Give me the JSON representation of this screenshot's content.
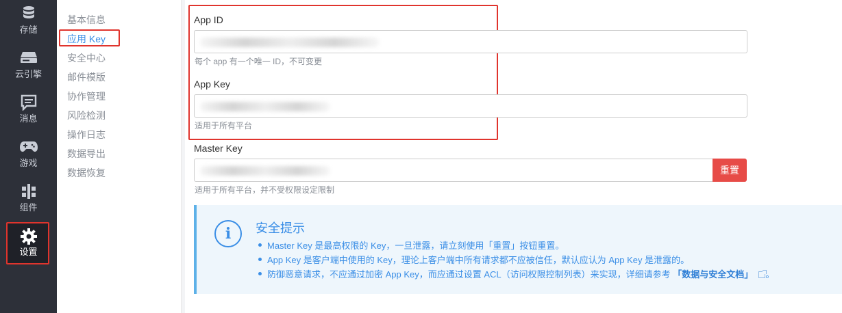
{
  "left_nav": {
    "items": [
      {
        "label": "存储",
        "icon": "database-icon"
      },
      {
        "label": "云引擎",
        "icon": "server-icon"
      },
      {
        "label": "消息",
        "icon": "message-icon"
      },
      {
        "label": "游戏",
        "icon": "gamepad-icon"
      },
      {
        "label": "组件",
        "icon": "component-icon"
      },
      {
        "label": "设置",
        "icon": "gear-icon",
        "active": true
      }
    ]
  },
  "sub_nav": {
    "items": [
      {
        "label": "基本信息"
      },
      {
        "label": "应用 Key",
        "active": true
      },
      {
        "label": "安全中心"
      },
      {
        "label": "邮件模版"
      },
      {
        "label": "协作管理"
      },
      {
        "label": "风险检测"
      },
      {
        "label": "操作日志"
      },
      {
        "label": "数据导出"
      },
      {
        "label": "数据恢复"
      }
    ]
  },
  "fields": {
    "app_id": {
      "label": "App ID",
      "help": "每个 app 有一个唯一 ID，不可变更"
    },
    "app_key": {
      "label": "App Key",
      "help": "适用于所有平台"
    },
    "master_key": {
      "label": "Master Key",
      "help": "适用于所有平台，并不受权限设定限制",
      "reset_label": "重置"
    }
  },
  "alert": {
    "title": "安全提示",
    "items": [
      "Master Key 是最高权限的 Key，一旦泄露，请立刻使用「重置」按钮重置。",
      "App Key 是客户端中使用的 Key，理论上客户端中所有请求都不应被信任，默认应认为 App Key 是泄露的。"
    ],
    "item3_text": "防御恶意请求，不应通过加密 App Key，而应通过设置 ACL（访问权限控制列表）来实现，详细请参考",
    "item3_link": "「数据与安全文档」",
    "item3_end": "。"
  },
  "colors": {
    "accent": "#3a8ee6",
    "danger": "#e74b47",
    "nav_bg": "#2d3039",
    "highlight": "#e0342d"
  }
}
